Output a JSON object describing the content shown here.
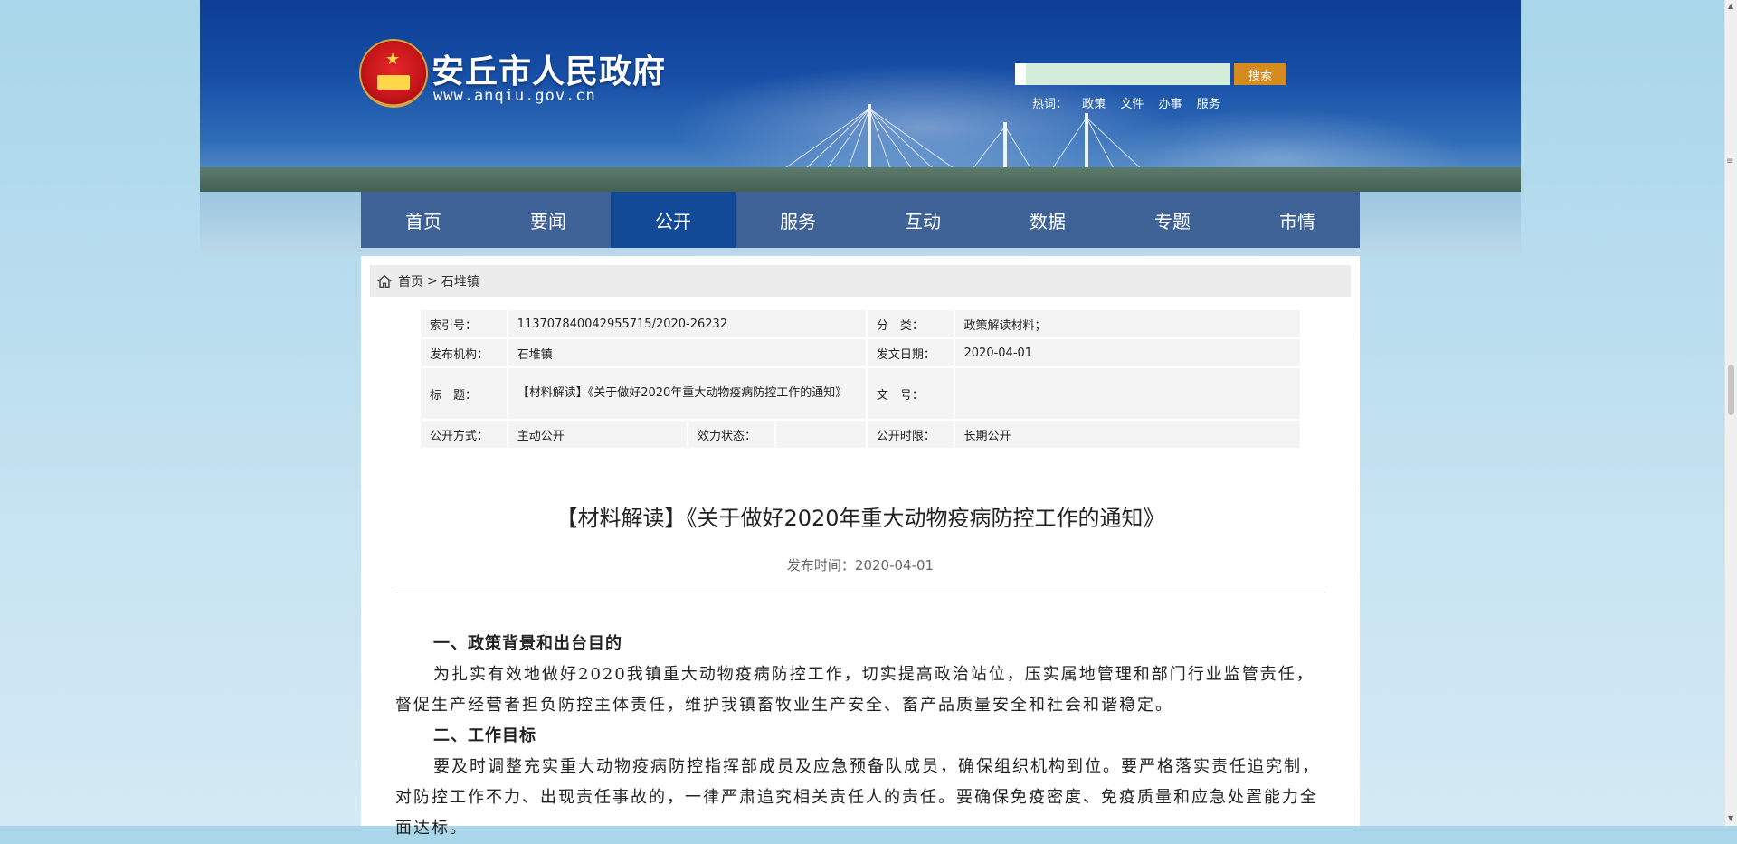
{
  "header": {
    "site_title": "安丘市人民政府",
    "site_url": "www.anqiu.gov.cn",
    "search_placeholder": "",
    "search_button": "搜索",
    "hot_words_label": "热词：",
    "hot_words": [
      "政策",
      "文件",
      "办事",
      "服务"
    ]
  },
  "nav": {
    "items": [
      "首页",
      "要闻",
      "公开",
      "服务",
      "互动",
      "数据",
      "专题",
      "市情"
    ],
    "active": "公开"
  },
  "breadcrumb": {
    "home": "首页",
    "separator": ">",
    "current": "石堆镇"
  },
  "meta": {
    "index_label": "索引号：",
    "index_value": "113707840042955715/2020-26232",
    "category_label": "分　类：",
    "category_value": "政策解读材料；",
    "publisher_label": "发布机构：",
    "publisher_value": "石堆镇",
    "date_label": "发文日期：",
    "date_value": "2020-04-01",
    "title_label": "标　题：",
    "title_value": "【材料解读】《关于做好2020年重大动物疫病防控工作的通知》",
    "doc_no_label": "文　号：",
    "doc_no_value": "",
    "open_mode_label": "公开方式：",
    "open_mode_value": "主动公开",
    "validity_label": "效力状态：",
    "validity_value": "",
    "open_period_label": "公开时限：",
    "open_period_value": "长期公开"
  },
  "article": {
    "title": "【材料解读】《关于做好2020年重大动物疫病防控工作的通知》",
    "publish_time": "发布时间：2020-04-01",
    "section1_heading": "一、政策背景和出台目的",
    "section1_body": "为扎实有效地做好2020我镇重大动物疫病防控工作，切实提高政治站位，压实属地管理和部门行业监管责任，督促生产经营者担负防控主体责任，维护我镇畜牧业生产安全、畜产品质量安全和社会和谐稳定。",
    "section2_heading": "二、工作目标",
    "section2_body": "要及时调整充实重大动物疫病防控指挥部成员及应急预备队成员，确保组织机构到位。要严格落实责任追究制，对防控工作不力、出现责任事故的，一律严肃追究相关责任人的责任。要确保免疫密度、免疫质量和应急处置能力全面达标。"
  },
  "colors": {
    "nav_bg": "#3f6296",
    "nav_active": "#134a98",
    "search_button": "#d68b1e"
  }
}
